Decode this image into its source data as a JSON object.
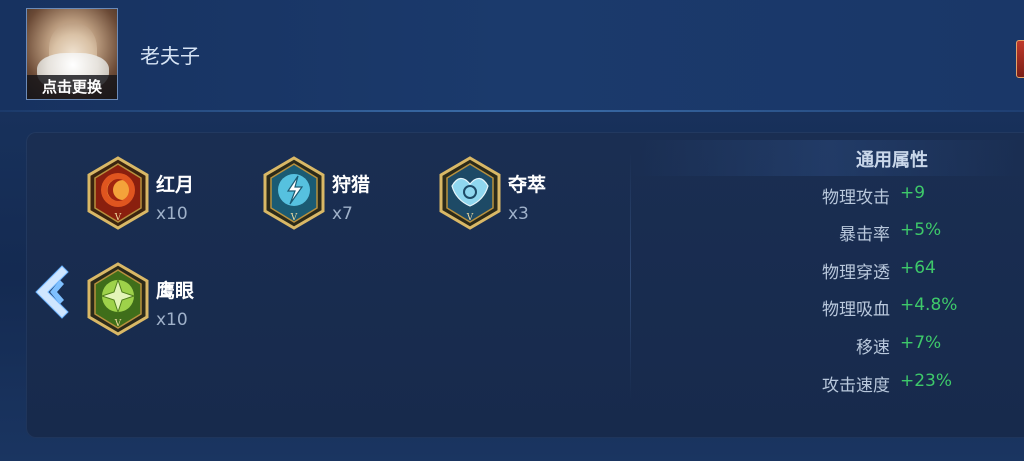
{
  "hero": {
    "name": "老夫子",
    "avatar_caption": "点击更换"
  },
  "runes": [
    {
      "name": "红月",
      "count": "x10",
      "color": "#d9471f",
      "icon": "red-moon-rune-icon"
    },
    {
      "name": "狩猎",
      "count": "x7",
      "color": "#3aa7c8",
      "icon": "hunt-rune-icon"
    },
    {
      "name": "夺萃",
      "count": "x3",
      "color": "#5fb6d8",
      "icon": "plunder-rune-icon"
    },
    {
      "name": "鹰眼",
      "count": "x10",
      "color": "#7fbf3a",
      "icon": "hawk-eye-rune-icon"
    }
  ],
  "stats": {
    "heading": "通用属性",
    "items": [
      {
        "label": "物理攻击",
        "value": "+9"
      },
      {
        "label": "暴击率",
        "value": "+5%"
      },
      {
        "label": "物理穿透",
        "value": "+64"
      },
      {
        "label": "物理吸血",
        "value": "+4.8%"
      },
      {
        "label": "移速",
        "value": "+7%"
      },
      {
        "label": "攻击速度",
        "value": "+23%"
      }
    ]
  },
  "colors": {
    "stat_value": "#3ec96a",
    "background": "#17305a",
    "frame_gold": "#c9a85a"
  }
}
